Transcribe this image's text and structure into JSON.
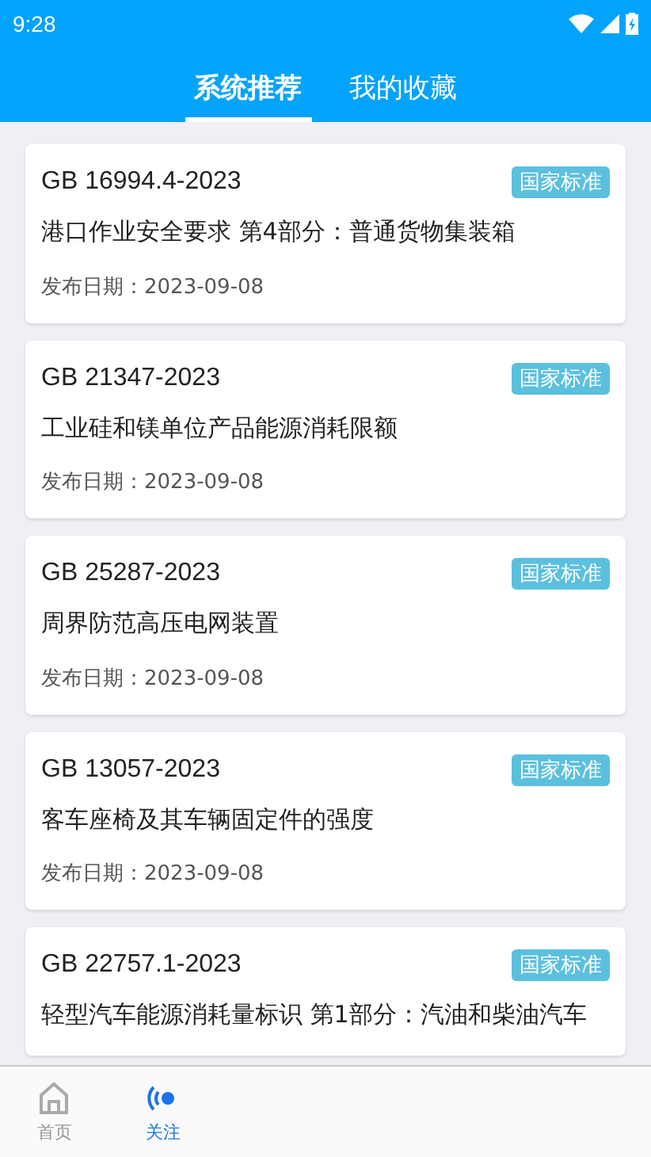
{
  "status_bar": {
    "time": "9:28"
  },
  "tabs": [
    {
      "label": "系统推荐",
      "selected": true
    },
    {
      "label": "我的收藏",
      "selected": false
    }
  ],
  "standards": [
    {
      "code": "GB 16994.4-2023",
      "tag": "国家标准",
      "title": "港口作业安全要求 第4部分：普通货物集装箱",
      "date": "发布日期：2023-09-08"
    },
    {
      "code": "GB 21347-2023",
      "tag": "国家标准",
      "title": "工业硅和镁单位产品能源消耗限额",
      "date": "发布日期：2023-09-08"
    },
    {
      "code": "GB 25287-2023",
      "tag": "国家标准",
      "title": "周界防范高压电网装置",
      "date": "发布日期：2023-09-08"
    },
    {
      "code": "GB 13057-2023",
      "tag": "国家标准",
      "title": "客车座椅及其车辆固定件的强度",
      "date": "发布日期：2023-09-08"
    },
    {
      "code": "GB 22757.1-2023",
      "tag": "国家标准",
      "title": "轻型汽车能源消耗量标识 第1部分：汽油和柴油汽车"
    }
  ],
  "bottom_nav": [
    {
      "label": "首页",
      "kind": "home",
      "selected": false
    },
    {
      "label": "关注",
      "kind": "signal",
      "selected": true
    }
  ]
}
